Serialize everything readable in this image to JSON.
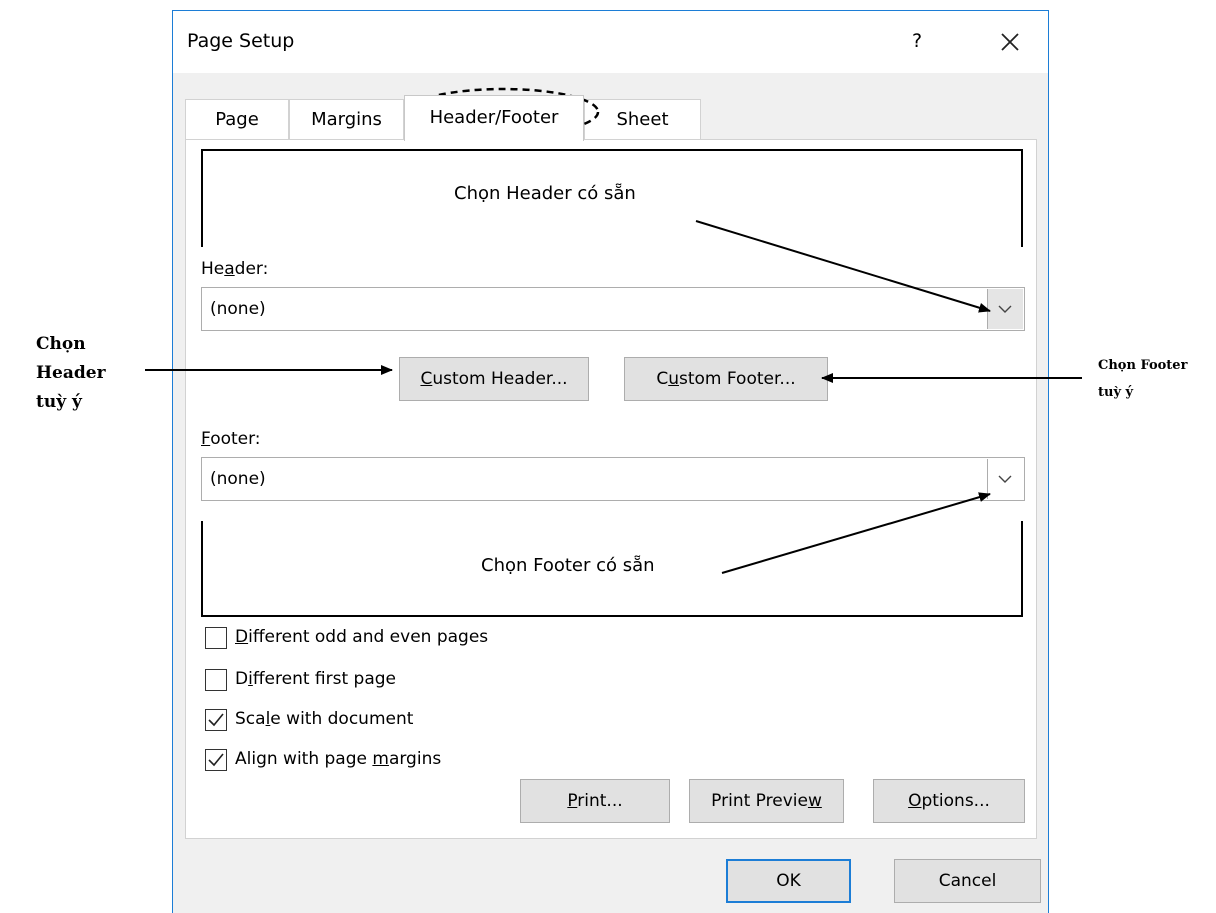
{
  "dialog": {
    "title": "Page Setup",
    "help_label": "?",
    "tabs": [
      {
        "pre": "Page",
        "key": "",
        "post": ""
      },
      {
        "pre": "Margins",
        "key": "",
        "post": ""
      },
      {
        "pre": "Header/Footer",
        "key": "",
        "post": ""
      },
      {
        "pre": "Sheet",
        "key": "",
        "post": ""
      }
    ],
    "active_tab": "Header/Footer",
    "header": {
      "label_pre": "He",
      "label_key": "a",
      "label_post": "der:",
      "value": "(none)"
    },
    "footer": {
      "label_pre": "",
      "label_key": "F",
      "label_post": "ooter:",
      "value": "(none)"
    },
    "custom_header_button": {
      "pre": "",
      "key": "C",
      "post": "ustom Header..."
    },
    "custom_footer_button": {
      "pre": "C",
      "key": "u",
      "post": "stom Footer..."
    },
    "checkboxes": [
      {
        "pre": "",
        "key": "D",
        "post": "ifferent odd and even pages",
        "checked": false
      },
      {
        "pre": "D",
        "key": "i",
        "post": "fferent first page",
        "checked": false
      },
      {
        "pre": "Sca",
        "key": "l",
        "post": "e with document",
        "checked": true
      },
      {
        "pre": "Align with page ",
        "key": "m",
        "post": "argins",
        "checked": true
      }
    ],
    "buttons": {
      "print": {
        "pre": "",
        "key": "P",
        "post": "rint..."
      },
      "print_preview": {
        "pre": "Print Previe",
        "key": "w",
        "post": ""
      },
      "options": {
        "pre": "",
        "key": "O",
        "post": "ptions..."
      },
      "ok": "OK",
      "cancel": "Cancel"
    }
  },
  "annotations": {
    "header_preset": "Chọn Header có sẵn",
    "footer_preset": "Chọn Footer có sẵn",
    "header_custom": [
      "Chọn",
      "Header",
      "tuỳ ý"
    ],
    "footer_custom": [
      "Chọn Footer",
      "tuỳ ý"
    ]
  },
  "colors": {
    "window_border": "#1c7dd6",
    "dialog_bg": "#f0f0f0",
    "button_bg": "#e1e1e1"
  }
}
